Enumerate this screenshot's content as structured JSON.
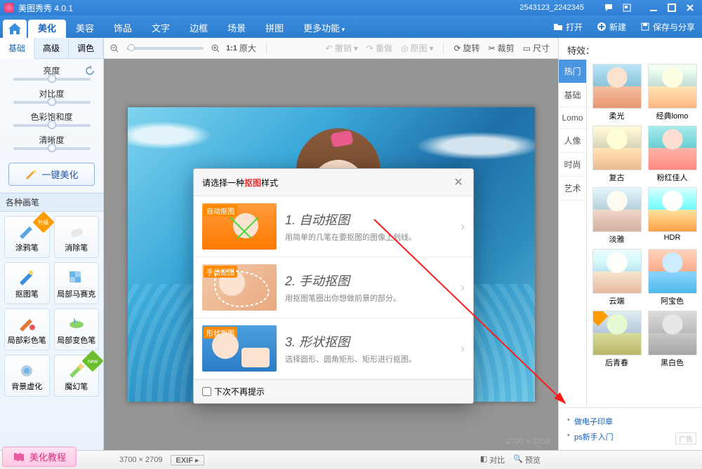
{
  "app": {
    "title": "美图秀秀 4.0.1",
    "account": "2543123_2242345"
  },
  "menuRight": {
    "open": "打开",
    "new": "新建",
    "saveShare": "保存与分享"
  },
  "mainTabs": [
    "美化",
    "美容",
    "饰品",
    "文字",
    "边框",
    "场景",
    "拼图",
    "更多功能"
  ],
  "mainTabActive": 0,
  "subTabs": [
    "基础",
    "高级",
    "调色"
  ],
  "subTabActive": 0,
  "sliders": [
    "亮度",
    "对比度",
    "色彩饱和度",
    "清晰度"
  ],
  "oneClick": "一键美化",
  "brushSection": "各种画笔",
  "brushes": [
    "涂鸦笔",
    "消除笔",
    "抠图笔",
    "局部马赛克",
    "局部彩色笔",
    "局部变色笔",
    "背景虚化",
    "魔幻笔"
  ],
  "toolbar": {
    "zoom": "1:1 原大",
    "undo": "撤销",
    "redo": "重做",
    "orig": "原图",
    "rotate": "旋转",
    "crop": "裁剪",
    "size": "尺寸"
  },
  "canvas": {
    "dims": "3700 × 2709",
    "sizelabel": "3700 × 2709"
  },
  "dialog": {
    "pre": "请选择一种",
    "hl": "抠图",
    "post": " 样式",
    "opts": [
      {
        "tag": "自动抠图",
        "title": "1. 自动抠图",
        "desc": "用简单的几笔在要抠图的图像上划线。"
      },
      {
        "tag": "手动抠图",
        "title": "2. 手动抠图",
        "desc": "用抠图笔圈出你想做前景的部分。"
      },
      {
        "tag": "形状抠图",
        "title": "3. 形状抠图",
        "desc": "选择圆形、圆角矩形、矩形进行抠图。"
      }
    ],
    "noremind": "下次不再提示"
  },
  "bottombar": {
    "exif": "EXIF",
    "compare": "对比",
    "preview": "预览"
  },
  "tutorial": "美化教程",
  "right": {
    "title": "特效：",
    "cats": [
      "热门",
      "基础",
      "Lomo",
      "人像",
      "时尚",
      "艺术"
    ],
    "catActive": 0,
    "effects": [
      "柔光",
      "经典lomo",
      "复古",
      "粉红佳人",
      "淡雅",
      "HDR",
      "云端",
      "阿宝色",
      "后青春",
      "黑白色"
    ]
  },
  "links": [
    "做电子印章",
    "ps新手入门"
  ],
  "adlabel": "广告"
}
